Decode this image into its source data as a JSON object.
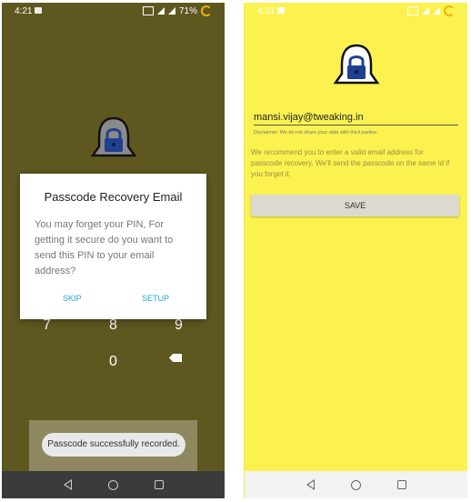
{
  "left_screen": {
    "status_bar": {
      "time": "4:21",
      "battery": "71%"
    },
    "dialog": {
      "title": "Passcode Recovery Email",
      "message": "You may forget your PIN, For getting it secure do you want to send this PIN to your email address?",
      "skip_label": "SKIP",
      "setup_label": "SETUP"
    },
    "keypad": {
      "seven": "7",
      "eight": "8",
      "nine": "9",
      "zero": "0"
    },
    "toast": "Passcode successfully recorded."
  },
  "right_screen": {
    "status_bar": {
      "time": "4:21"
    },
    "email_value": "mansi.vijay@tweaking.in",
    "disclaimer": "Disclaimer: We do not share your data with third parties.",
    "recommendation": "We recommend you to enter a valid email address for passcode recovery. We'll send the passcode on the same id if you forget it.",
    "save_label": "SAVE"
  },
  "colors": {
    "left_background": "#5e5820",
    "right_background": "#fbf250",
    "accent": "#2aa7d3",
    "lock_blue": "#1f3f8f"
  },
  "icons": [
    "bell-lock-icon",
    "backspace-icon",
    "back-nav-icon",
    "home-nav-icon",
    "recents-nav-icon"
  ]
}
